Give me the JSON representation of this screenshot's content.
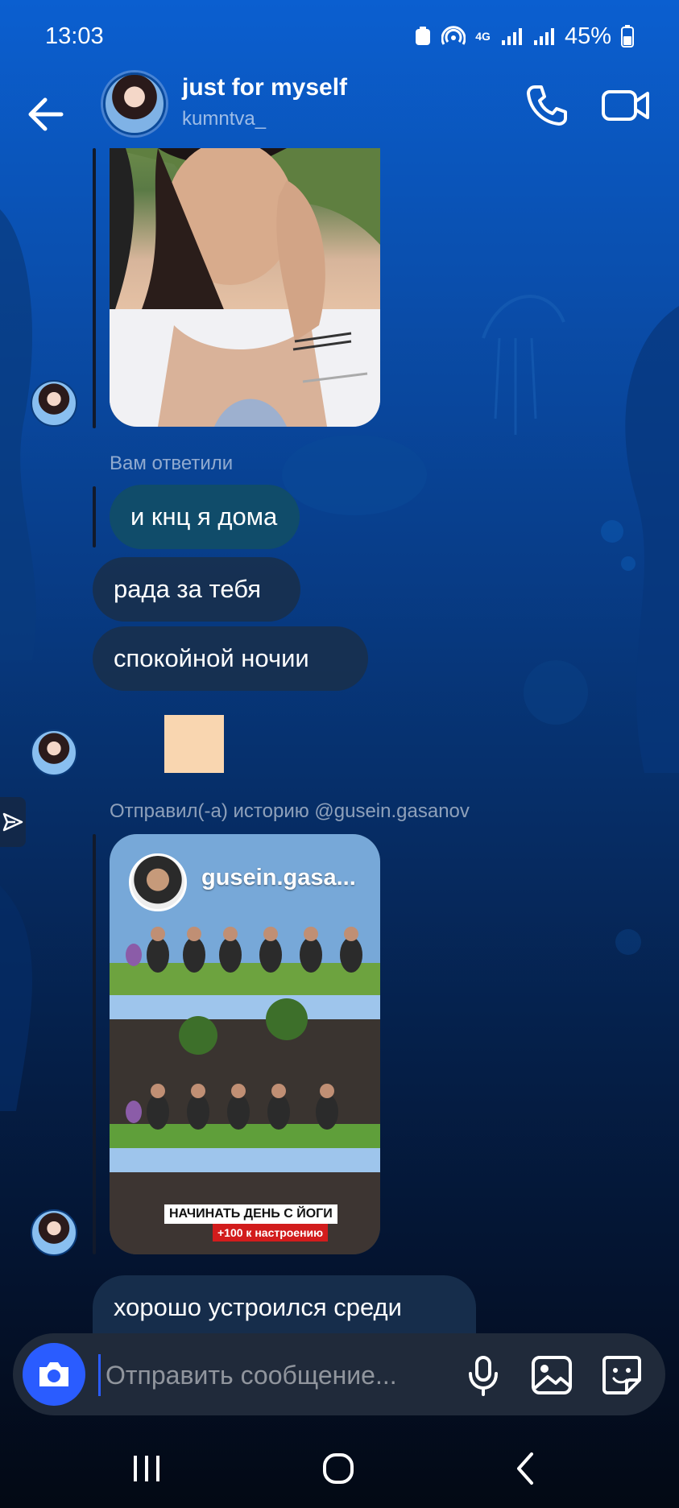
{
  "status_bar": {
    "time": "13:03",
    "network": "4G",
    "battery": "45%"
  },
  "header": {
    "title": "just for myself",
    "username": "kumntva_"
  },
  "messages": {
    "reply_label": "Вам ответили",
    "replied_text": "и кнц я дома",
    "msg1": "рада за тебя",
    "msg2": "спокойной ночии",
    "story_label": "Отправил(-а) историю @gusein.gasanov",
    "story_author": "gusein.gasa...",
    "story_caption_line1": "НАЧИНАТЬ ДЕНЬ С ЙОГИ",
    "story_caption_line2": "+100 к настроению",
    "msg3": "хорошо устроился среди"
  },
  "composer": {
    "placeholder": "Отправить сообщение..."
  },
  "icons": {
    "back": "arrow-left-icon",
    "call": "phone-icon",
    "video": "video-camera-icon",
    "camera": "camera-icon",
    "mic": "microphone-icon",
    "gallery": "image-icon",
    "sticker": "sticker-icon",
    "share": "send-icon"
  },
  "colors": {
    "accent": "#2a5cff",
    "bubble": "#18304e",
    "replied_bubble": "#124e66"
  }
}
